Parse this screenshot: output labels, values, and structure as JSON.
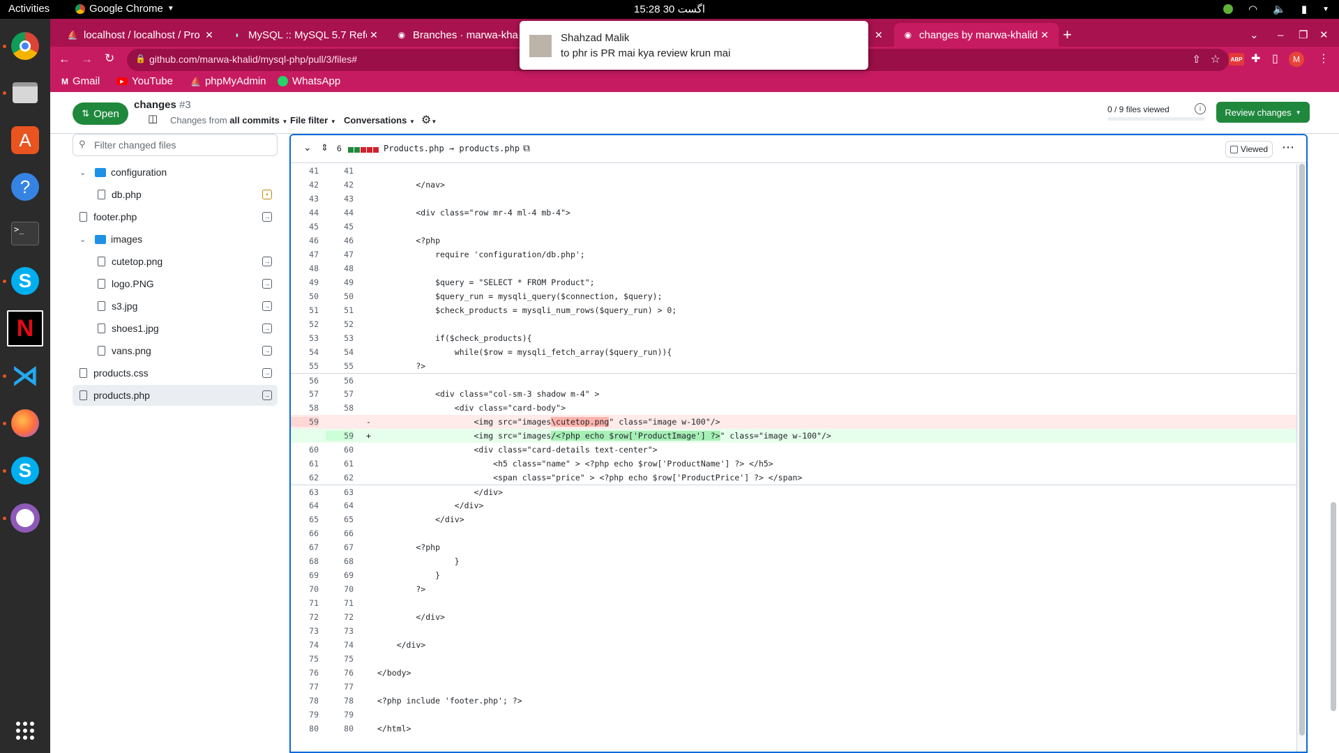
{
  "gnome": {
    "activities": "Activities",
    "app_name": "Google Chrome",
    "clock": "15:28  30 اگست"
  },
  "dock": {
    "items": [
      "chrome-icon",
      "files-icon",
      "ubuntu-software-icon",
      "help-icon",
      "terminal-icon",
      "skype-icon",
      "netflix-icon",
      "vscode-icon",
      "firefox-icon",
      "skype-icon",
      "github-desktop-icon",
      "app-grid-icon"
    ]
  },
  "browser": {
    "tabs": [
      {
        "title": "localhost / localhost / Pro"
      },
      {
        "title": "MySQL :: MySQL 5.7 Refer"
      },
      {
        "title": "Branches · marwa-kha"
      },
      {
        "title": "changes by marwa-khalid"
      }
    ],
    "url": "github.com/marwa-khalid/mysql-php/pull/3/files#",
    "bookmarks": [
      "Gmail",
      "YouTube",
      "phpMyAdmin",
      "WhatsApp"
    ],
    "profile_initial": "M",
    "abp": "ABP"
  },
  "notification": {
    "title": "Shahzad Malik",
    "body": "to phr is PR mai kya review krun mai"
  },
  "pr": {
    "status": "Open",
    "title": "changes",
    "number": "#3",
    "changes_from": "Changes from",
    "all_commits": "all commits",
    "file_filter": "File filter",
    "conversations": "Conversations",
    "files_viewed": "0 / 9 files viewed",
    "review_button": "Review changes",
    "filter_placeholder": "Filter changed files"
  },
  "tree": [
    {
      "type": "folder",
      "name": "configuration",
      "depth": 0
    },
    {
      "type": "file",
      "name": "db.php",
      "depth": 1,
      "status": "modified"
    },
    {
      "type": "file",
      "name": "footer.php",
      "depth": 0,
      "status": "added"
    },
    {
      "type": "folder",
      "name": "images",
      "depth": 0
    },
    {
      "type": "file",
      "name": "cutetop.png",
      "depth": 1,
      "status": "added"
    },
    {
      "type": "file",
      "name": "logo.PNG",
      "depth": 1,
      "status": "added"
    },
    {
      "type": "file",
      "name": "s3.jpg",
      "depth": 1,
      "status": "added"
    },
    {
      "type": "file",
      "name": "shoes1.jpg",
      "depth": 1,
      "status": "added"
    },
    {
      "type": "file",
      "name": "vans.png",
      "depth": 1,
      "status": "added"
    },
    {
      "type": "file",
      "name": "products.css",
      "depth": 0,
      "status": "added"
    },
    {
      "type": "file",
      "name": "products.php",
      "depth": 0,
      "status": "added",
      "selected": true
    }
  ],
  "diff": {
    "change_count": "6",
    "file_rename": "Products.php → products.php",
    "viewed_label": "Viewed",
    "lines": [
      {
        "o": "41",
        "n": "41",
        "t": "ctx",
        "c": ""
      },
      {
        "o": "42",
        "n": "42",
        "t": "ctx",
        "c": "        </nav>"
      },
      {
        "o": "43",
        "n": "43",
        "t": "ctx",
        "c": ""
      },
      {
        "o": "44",
        "n": "44",
        "t": "ctx",
        "c": "        <div class=\"row mr-4 ml-4 mb-4\">"
      },
      {
        "o": "45",
        "n": "45",
        "t": "ctx",
        "c": ""
      },
      {
        "o": "46",
        "n": "46",
        "t": "ctx",
        "c": "        <?php"
      },
      {
        "o": "47",
        "n": "47",
        "t": "ctx",
        "c": "            require 'configuration/db.php';"
      },
      {
        "o": "48",
        "n": "48",
        "t": "ctx",
        "c": ""
      },
      {
        "o": "49",
        "n": "49",
        "t": "ctx",
        "c": "            $query = \"SELECT * FROM Product\";"
      },
      {
        "o": "50",
        "n": "50",
        "t": "ctx",
        "c": "            $query_run = mysqli_query($connection, $query);"
      },
      {
        "o": "51",
        "n": "51",
        "t": "ctx",
        "c": "            $check_products = mysqli_num_rows($query_run) > 0;"
      },
      {
        "o": "52",
        "n": "52",
        "t": "ctx",
        "c": ""
      },
      {
        "o": "53",
        "n": "53",
        "t": "ctx",
        "c": "            if($check_products){"
      },
      {
        "o": "54",
        "n": "54",
        "t": "ctx",
        "c": "                while($row = mysqli_fetch_array($query_run)){"
      },
      {
        "o": "55",
        "n": "55",
        "t": "ctx",
        "c": "        ?>"
      },
      {
        "o": "56",
        "n": "56",
        "t": "ctx",
        "c": "",
        "hunk": true
      },
      {
        "o": "57",
        "n": "57",
        "t": "ctx",
        "c": "            <div class=\"col-sm-3 shadow m-4\" >"
      },
      {
        "o": "58",
        "n": "58",
        "t": "ctx",
        "c": "                <div class=\"card-body\">"
      },
      {
        "o": "59",
        "n": "",
        "t": "del",
        "m": "-",
        "pre": "                    <img src=\"images",
        "hl": "\\cutetop.png",
        "post": "\" class=\"image w-100\"/>"
      },
      {
        "o": "",
        "n": "59",
        "t": "add",
        "m": "+",
        "pre": "                    <img src=\"images",
        "hl": "/<?php echo $row['ProductImage'] ?>",
        "post": "\" class=\"image w-100\"/>"
      },
      {
        "o": "60",
        "n": "60",
        "t": "ctx",
        "c": "                    <div class=\"card-details text-center\">"
      },
      {
        "o": "61",
        "n": "61",
        "t": "ctx",
        "c": "                        <h5 class=\"name\" > <?php echo $row['ProductName'] ?> </h5>"
      },
      {
        "o": "62",
        "n": "62",
        "t": "ctx",
        "c": "                        <span class=\"price\" > <?php echo $row['ProductPrice'] ?> </span>"
      },
      {
        "o": "63",
        "n": "63",
        "t": "ctx",
        "c": "                    </div>",
        "hunk": true
      },
      {
        "o": "64",
        "n": "64",
        "t": "ctx",
        "c": "                </div>"
      },
      {
        "o": "65",
        "n": "65",
        "t": "ctx",
        "c": "            </div>"
      },
      {
        "o": "66",
        "n": "66",
        "t": "ctx",
        "c": ""
      },
      {
        "o": "67",
        "n": "67",
        "t": "ctx",
        "c": "        <?php"
      },
      {
        "o": "68",
        "n": "68",
        "t": "ctx",
        "c": "                }"
      },
      {
        "o": "69",
        "n": "69",
        "t": "ctx",
        "c": "            }"
      },
      {
        "o": "70",
        "n": "70",
        "t": "ctx",
        "c": "        ?>"
      },
      {
        "o": "71",
        "n": "71",
        "t": "ctx",
        "c": ""
      },
      {
        "o": "72",
        "n": "72",
        "t": "ctx",
        "c": "        </div>"
      },
      {
        "o": "73",
        "n": "73",
        "t": "ctx",
        "c": ""
      },
      {
        "o": "74",
        "n": "74",
        "t": "ctx",
        "c": "    </div>"
      },
      {
        "o": "75",
        "n": "75",
        "t": "ctx",
        "c": ""
      },
      {
        "o": "76",
        "n": "76",
        "t": "ctx",
        "c": "</body>"
      },
      {
        "o": "77",
        "n": "77",
        "t": "ctx",
        "c": ""
      },
      {
        "o": "78",
        "n": "78",
        "t": "ctx",
        "c": "<?php include 'footer.php'; ?>"
      },
      {
        "o": "79",
        "n": "79",
        "t": "ctx",
        "c": ""
      },
      {
        "o": "80",
        "n": "80",
        "t": "ctx",
        "c": "</html>"
      }
    ]
  },
  "colors": {
    "chrome_frame": "#a8124e",
    "chrome_toolbar": "#c71b61",
    "github_green": "#1f883d",
    "focus_blue": "#0969da"
  }
}
